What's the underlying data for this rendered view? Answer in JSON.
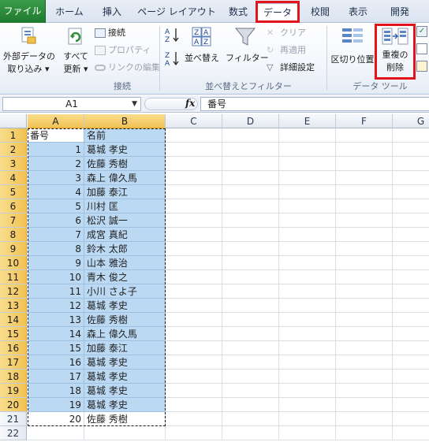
{
  "tabs": [
    {
      "label": "ファイル"
    },
    {
      "label": "ホーム"
    },
    {
      "label": "挿入"
    },
    {
      "label": "ページ レイアウト"
    },
    {
      "label": "数式"
    },
    {
      "label": "データ"
    },
    {
      "label": "校閲"
    },
    {
      "label": "表示"
    },
    {
      "label": "開発"
    }
  ],
  "ribbon": {
    "external_data": {
      "line1": "外部データの",
      "line2": "取り込み ▾"
    },
    "refresh_all": {
      "line1": "すべて",
      "line2": "更新 ▾"
    },
    "connections": "接続",
    "properties": "プロパティ",
    "edit_links": "リンクの編集",
    "group_connections": "接続",
    "sort": "並べ替え",
    "filter": "フィルター",
    "clear": "クリア",
    "reapply": "再適用",
    "advanced": "詳細設定",
    "group_sort_filter": "並べ替えとフィルター",
    "text_to_columns": "区切り位置",
    "remove_duplicates": {
      "line1": "重複の",
      "line2": "削除"
    },
    "group_data_tools": "データ ツール"
  },
  "formula_bar": {
    "name_box": "A1",
    "fx": "fx",
    "value": "番号"
  },
  "columns": [
    "A",
    "B",
    "C",
    "D",
    "E",
    "F",
    "G"
  ],
  "rows": [
    {
      "n": "1",
      "a": "番号",
      "b": "名前"
    },
    {
      "n": "2",
      "a": "1",
      "b": "葛城 孝史"
    },
    {
      "n": "3",
      "a": "2",
      "b": "佐藤 秀樹"
    },
    {
      "n": "4",
      "a": "3",
      "b": "森上 偉久馬"
    },
    {
      "n": "5",
      "a": "4",
      "b": "加藤 泰江"
    },
    {
      "n": "6",
      "a": "5",
      "b": "川村 匡"
    },
    {
      "n": "7",
      "a": "6",
      "b": "松沢 誠一"
    },
    {
      "n": "8",
      "a": "7",
      "b": "成宮 真紀"
    },
    {
      "n": "9",
      "a": "8",
      "b": "鈴木 太郎"
    },
    {
      "n": "10",
      "a": "9",
      "b": "山本 雅治"
    },
    {
      "n": "11",
      "a": "10",
      "b": "青木 俊之"
    },
    {
      "n": "12",
      "a": "11",
      "b": "小川 さよ子"
    },
    {
      "n": "13",
      "a": "12",
      "b": "葛城 孝史"
    },
    {
      "n": "14",
      "a": "13",
      "b": "佐藤 秀樹"
    },
    {
      "n": "15",
      "a": "14",
      "b": "森上 偉久馬"
    },
    {
      "n": "16",
      "a": "15",
      "b": "加藤 泰江"
    },
    {
      "n": "17",
      "a": "16",
      "b": "葛城 孝史"
    },
    {
      "n": "18",
      "a": "17",
      "b": "葛城 孝史"
    },
    {
      "n": "19",
      "a": "18",
      "b": "葛城 孝史"
    },
    {
      "n": "20",
      "a": "19",
      "b": "葛城 孝史"
    },
    {
      "n": "21",
      "a": "20",
      "b": "佐藤 秀樹"
    },
    {
      "n": "22",
      "a": "",
      "b": ""
    }
  ],
  "colors": {
    "highlight": "#e3131c",
    "selection": "#bcd9f3",
    "header_selected": "#f1c254"
  }
}
